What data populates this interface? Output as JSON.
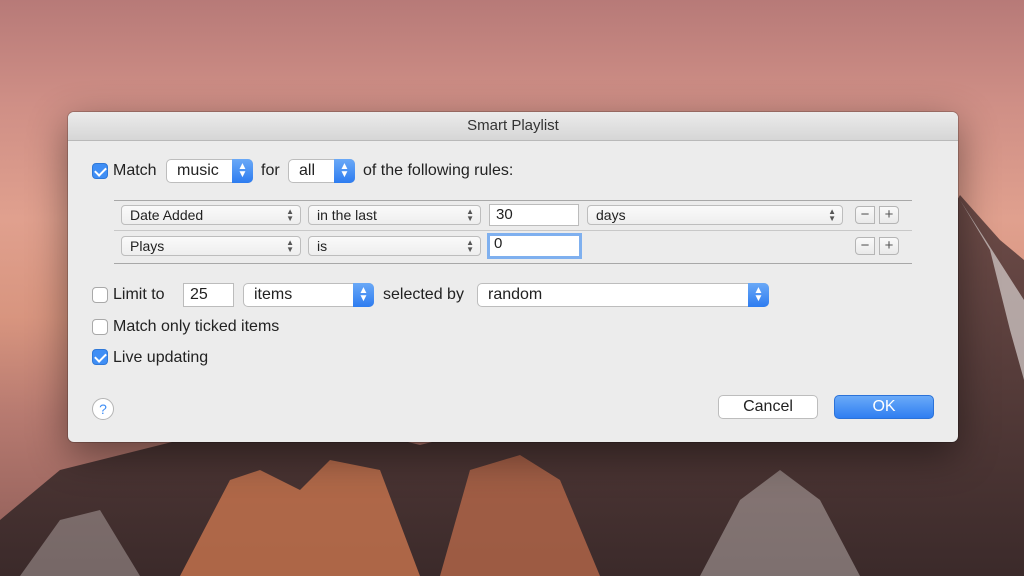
{
  "dialog": {
    "title": "Smart Playlist"
  },
  "match": {
    "checked": true,
    "label": "Match",
    "media": "music",
    "for_label": "for",
    "scope": "all",
    "suffix": "of the following rules:"
  },
  "rules": [
    {
      "field": "Date Added",
      "operator": "in the last",
      "value": "30",
      "unit": "days"
    },
    {
      "field": "Plays",
      "operator": "is",
      "value": "0"
    }
  ],
  "rule_buttons": {
    "remove": "−",
    "add": "+"
  },
  "limit": {
    "checked": false,
    "label": "Limit to",
    "count": "25",
    "unit": "items",
    "selected_by_label": "selected by",
    "selected_by": "random"
  },
  "options": {
    "ticked_only": {
      "checked": false,
      "label": "Match only ticked items"
    },
    "live_updating": {
      "checked": true,
      "label": "Live updating"
    }
  },
  "footer": {
    "help": "?",
    "cancel": "Cancel",
    "ok": "OK"
  },
  "colors": {
    "accent": "#3f8ef5",
    "focus_ring": "#7fb0ef"
  }
}
